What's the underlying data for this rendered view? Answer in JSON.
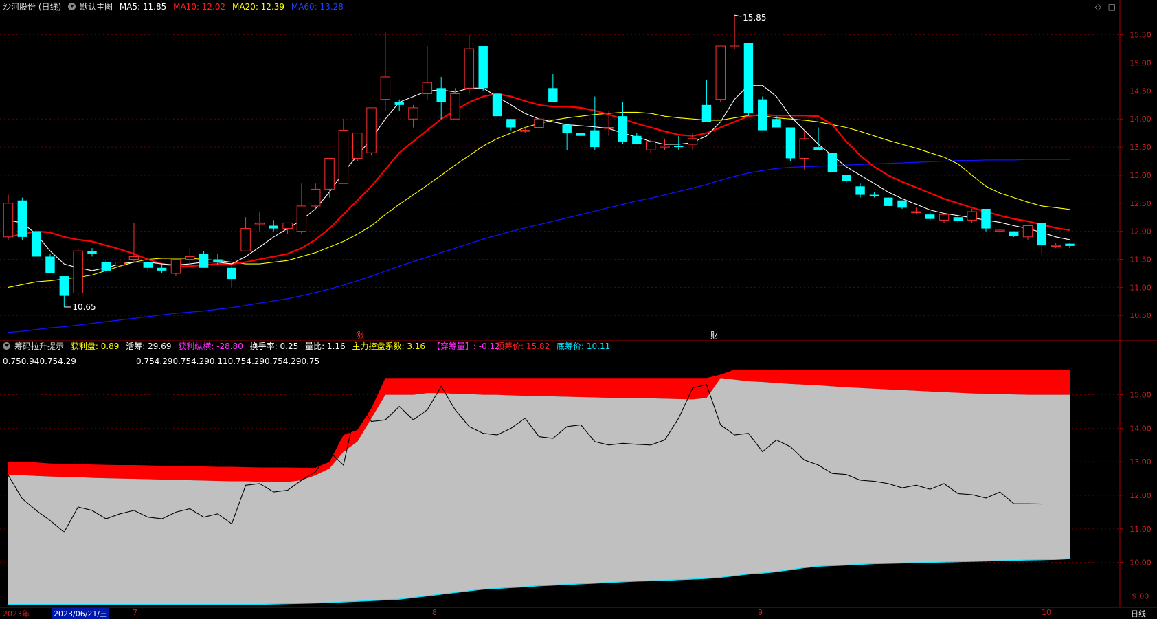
{
  "main_header": {
    "stock": "沙河股份 (日线)",
    "template": "默认主图",
    "ma5": "MA5: 11.85",
    "ma10": "MA10: 12.02",
    "ma20": "MA20: 12.39",
    "ma60": "MA60: 13.28"
  },
  "sub_header": {
    "name": "筹码拉升提示",
    "profit": "获利盘: 0.89",
    "active": "活筹: 29.69",
    "profit_vert": "获利纵横: -28.80",
    "turnover": "换手率: 0.25",
    "volume_ratio": "量比: 1.16",
    "control": "主力控盘系数: 3.16",
    "penetrate": "【穿筹量】: -0.12",
    "top_price": "顶筹价: 15.82",
    "bottom_price": "底筹价: 10.11"
  },
  "sub_values": {
    "left": "0.750.940.754.29",
    "mid": "0.754.290.754.290.110.754.290.754.290.75"
  },
  "annotations": {
    "high": "15.85",
    "low": "10.65",
    "marker_zhang": "涨",
    "marker_cai": "财"
  },
  "bottom_bar": {
    "year": "2023年",
    "date": "2023/06/21/三",
    "m7": "7",
    "m8": "8",
    "m9": "9",
    "m10": "10",
    "period": "日线"
  },
  "colors": {
    "up": "#ff3030",
    "down": "#00ffff",
    "ma5": "#ffffff",
    "ma10": "#ff0000",
    "ma20": "#ffff00",
    "ma60": "#1010ff",
    "axis": "#c00000"
  },
  "chart_data": [
    {
      "type": "candlestick",
      "title": "沙河股份 (日线)",
      "y_ticks": [
        15.5,
        15.0,
        14.5,
        14.0,
        13.5,
        13.0,
        12.5,
        12.0,
        11.5,
        11.0,
        10.5
      ],
      "ylim": [
        10.05,
        15.9
      ],
      "x_labels": [
        "7",
        "8",
        "9",
        "10"
      ],
      "candles": [
        {
          "o": 11.9,
          "h": 12.65,
          "l": 11.85,
          "c": 12.5
        },
        {
          "o": 12.55,
          "h": 12.6,
          "l": 11.85,
          "c": 11.9
        },
        {
          "o": 12.0,
          "h": 12.0,
          "l": 11.55,
          "c": 11.55
        },
        {
          "o": 11.55,
          "h": 11.6,
          "l": 11.25,
          "c": 11.25
        },
        {
          "o": 11.2,
          "h": 11.2,
          "l": 10.65,
          "c": 10.85
        },
        {
          "o": 10.9,
          "h": 11.7,
          "l": 10.85,
          "c": 11.65
        },
        {
          "o": 11.65,
          "h": 11.7,
          "l": 11.55,
          "c": 11.6
        },
        {
          "o": 11.45,
          "h": 11.5,
          "l": 11.25,
          "c": 11.3
        },
        {
          "o": 11.4,
          "h": 11.5,
          "l": 11.35,
          "c": 11.45
        },
        {
          "o": 11.5,
          "h": 12.15,
          "l": 11.45,
          "c": 11.55
        },
        {
          "o": 11.45,
          "h": 11.45,
          "l": 11.3,
          "c": 11.35
        },
        {
          "o": 11.35,
          "h": 11.4,
          "l": 11.25,
          "c": 11.3
        },
        {
          "o": 11.25,
          "h": 11.5,
          "l": 11.2,
          "c": 11.5
        },
        {
          "o": 11.5,
          "h": 11.7,
          "l": 11.4,
          "c": 11.55
        },
        {
          "o": 11.6,
          "h": 11.65,
          "l": 11.35,
          "c": 11.35
        },
        {
          "o": 11.5,
          "h": 11.6,
          "l": 11.4,
          "c": 11.45
        },
        {
          "o": 11.35,
          "h": 11.4,
          "l": 11.0,
          "c": 11.15
        },
        {
          "o": 11.65,
          "h": 12.25,
          "l": 11.65,
          "c": 12.05
        },
        {
          "o": 12.15,
          "h": 12.35,
          "l": 12.0,
          "c": 12.15
        },
        {
          "o": 12.1,
          "h": 12.2,
          "l": 12.0,
          "c": 12.05
        },
        {
          "o": 12.05,
          "h": 12.15,
          "l": 11.95,
          "c": 12.15
        },
        {
          "o": 12.0,
          "h": 12.85,
          "l": 11.95,
          "c": 12.45
        },
        {
          "o": 12.45,
          "h": 12.85,
          "l": 12.4,
          "c": 12.75
        },
        {
          "o": 12.75,
          "h": 13.1,
          "l": 12.6,
          "c": 13.3
        },
        {
          "o": 12.85,
          "h": 14.0,
          "l": 12.85,
          "c": 13.8
        },
        {
          "o": 13.3,
          "h": 13.75,
          "l": 13.25,
          "c": 13.75
        },
        {
          "o": 13.4,
          "h": 14.2,
          "l": 13.35,
          "c": 14.2
        },
        {
          "o": 14.35,
          "h": 15.55,
          "l": 14.15,
          "c": 14.75
        },
        {
          "o": 14.3,
          "h": 14.35,
          "l": 14.15,
          "c": 14.25
        },
        {
          "o": 14.0,
          "h": 14.25,
          "l": 13.85,
          "c": 14.2
        },
        {
          "o": 14.45,
          "h": 15.3,
          "l": 14.35,
          "c": 14.65
        },
        {
          "o": 14.55,
          "h": 14.75,
          "l": 14.0,
          "c": 14.3
        },
        {
          "o": 14.0,
          "h": 14.55,
          "l": 14.0,
          "c": 14.45
        },
        {
          "o": 14.55,
          "h": 15.5,
          "l": 14.45,
          "c": 15.25
        },
        {
          "o": 15.3,
          "h": 15.3,
          "l": 14.5,
          "c": 14.55
        },
        {
          "o": 14.45,
          "h": 14.5,
          "l": 14.0,
          "c": 14.05
        },
        {
          "o": 14.0,
          "h": 14.0,
          "l": 13.8,
          "c": 13.85
        },
        {
          "o": 13.8,
          "h": 13.85,
          "l": 13.75,
          "c": 13.8
        },
        {
          "o": 13.85,
          "h": 14.1,
          "l": 13.8,
          "c": 14.0
        },
        {
          "o": 14.55,
          "h": 14.8,
          "l": 14.3,
          "c": 14.3
        },
        {
          "o": 13.9,
          "h": 13.9,
          "l": 13.45,
          "c": 13.75
        },
        {
          "o": 13.75,
          "h": 13.8,
          "l": 13.55,
          "c": 13.7
        },
        {
          "o": 13.8,
          "h": 14.4,
          "l": 13.45,
          "c": 13.5
        },
        {
          "o": 13.85,
          "h": 14.15,
          "l": 13.7,
          "c": 13.85
        },
        {
          "o": 14.05,
          "h": 14.3,
          "l": 13.55,
          "c": 13.6
        },
        {
          "o": 13.7,
          "h": 13.75,
          "l": 13.55,
          "c": 13.55
        },
        {
          "o": 13.45,
          "h": 13.65,
          "l": 13.4,
          "c": 13.6
        },
        {
          "o": 13.5,
          "h": 13.65,
          "l": 13.45,
          "c": 13.52
        },
        {
          "o": 13.52,
          "h": 13.7,
          "l": 13.45,
          "c": 13.5
        },
        {
          "o": 13.55,
          "h": 13.75,
          "l": 13.45,
          "c": 13.65
        },
        {
          "o": 14.25,
          "h": 14.7,
          "l": 13.95,
          "c": 13.95
        },
        {
          "o": 14.35,
          "h": 15.3,
          "l": 14.3,
          "c": 15.3
        },
        {
          "o": 15.3,
          "h": 15.85,
          "l": 15.25,
          "c": 15.3
        },
        {
          "o": 15.35,
          "h": 15.35,
          "l": 14.05,
          "c": 14.1
        },
        {
          "o": 14.35,
          "h": 14.4,
          "l": 13.8,
          "c": 13.8
        },
        {
          "o": 14.0,
          "h": 14.05,
          "l": 13.85,
          "c": 13.85
        },
        {
          "o": 13.85,
          "h": 13.85,
          "l": 13.25,
          "c": 13.3
        },
        {
          "o": 13.3,
          "h": 13.8,
          "l": 13.1,
          "c": 13.65
        },
        {
          "o": 13.5,
          "h": 13.85,
          "l": 13.45,
          "c": 13.45
        },
        {
          "o": 13.4,
          "h": 13.4,
          "l": 13.05,
          "c": 13.05
        },
        {
          "o": 13.0,
          "h": 13.0,
          "l": 12.85,
          "c": 12.9
        },
        {
          "o": 12.8,
          "h": 12.85,
          "l": 12.6,
          "c": 12.65
        },
        {
          "o": 12.65,
          "h": 12.7,
          "l": 12.6,
          "c": 12.62
        },
        {
          "o": 12.6,
          "h": 12.6,
          "l": 12.45,
          "c": 12.45
        },
        {
          "o": 12.55,
          "h": 12.55,
          "l": 12.4,
          "c": 12.42
        },
        {
          "o": 12.35,
          "h": 12.42,
          "l": 12.3,
          "c": 12.35
        },
        {
          "o": 12.3,
          "h": 12.35,
          "l": 12.2,
          "c": 12.22
        },
        {
          "o": 12.2,
          "h": 12.3,
          "l": 12.15,
          "c": 12.3
        },
        {
          "o": 12.25,
          "h": 12.3,
          "l": 12.15,
          "c": 12.18
        },
        {
          "o": 12.2,
          "h": 12.4,
          "l": 12.15,
          "c": 12.35
        },
        {
          "o": 12.4,
          "h": 12.4,
          "l": 12.0,
          "c": 12.05
        },
        {
          "o": 12.0,
          "h": 12.05,
          "l": 11.95,
          "c": 12.02
        },
        {
          "o": 12.0,
          "h": 12.0,
          "l": 11.9,
          "c": 11.92
        },
        {
          "o": 11.9,
          "h": 12.1,
          "l": 11.85,
          "c": 12.1
        },
        {
          "o": 12.15,
          "h": 12.15,
          "l": 11.6,
          "c": 11.75
        },
        {
          "o": 11.75,
          "h": 11.8,
          "l": 11.7,
          "c": 11.75
        },
        {
          "o": 11.78,
          "h": 11.8,
          "l": 11.7,
          "c": 11.74
        }
      ],
      "ma5": [
        12.2,
        12.15,
        11.95,
        11.65,
        11.42,
        11.35,
        11.3,
        11.35,
        11.42,
        11.45,
        11.45,
        11.42,
        11.4,
        11.42,
        11.45,
        11.45,
        11.42,
        11.55,
        11.72,
        11.9,
        12.05,
        12.2,
        12.4,
        12.7,
        13.05,
        13.35,
        13.65,
        14.0,
        14.3,
        14.4,
        14.5,
        14.52,
        14.48,
        14.55,
        14.55,
        14.4,
        14.25,
        14.1,
        14.0,
        13.95,
        13.9,
        13.88,
        13.86,
        13.83,
        13.75,
        13.68,
        13.6,
        13.55,
        13.55,
        13.58,
        13.7,
        13.95,
        14.35,
        14.6,
        14.6,
        14.4,
        14.05,
        13.8,
        13.55,
        13.35,
        13.15,
        13.0,
        12.85,
        12.7,
        12.58,
        12.48,
        12.38,
        12.32,
        12.28,
        12.24,
        12.2,
        12.16,
        12.1,
        12.05,
        11.98,
        11.9,
        11.85
      ],
      "ma10": [
        11.9,
        11.95,
        12.0,
        11.98,
        11.9,
        11.85,
        11.82,
        11.75,
        11.68,
        11.6,
        11.5,
        11.42,
        11.38,
        11.38,
        11.4,
        11.42,
        11.42,
        11.45,
        11.5,
        11.55,
        11.6,
        11.7,
        11.85,
        12.05,
        12.3,
        12.55,
        12.8,
        13.1,
        13.4,
        13.6,
        13.8,
        14.0,
        14.15,
        14.3,
        14.4,
        14.45,
        14.4,
        14.32,
        14.25,
        14.22,
        14.22,
        14.2,
        14.15,
        14.08,
        14.0,
        13.92,
        13.85,
        13.78,
        13.72,
        13.7,
        13.75,
        13.85,
        13.95,
        14.05,
        14.08,
        14.06,
        14.06,
        14.06,
        14.05,
        13.9,
        13.6,
        13.35,
        13.15,
        13.0,
        12.88,
        12.78,
        12.68,
        12.58,
        12.5,
        12.42,
        12.35,
        12.28,
        12.22,
        12.18,
        12.12,
        12.06,
        12.02
      ],
      "ma20": [
        11.0,
        11.05,
        11.1,
        11.12,
        11.15,
        11.18,
        11.22,
        11.3,
        11.38,
        11.45,
        11.5,
        11.52,
        11.52,
        11.52,
        11.5,
        11.48,
        11.45,
        11.42,
        11.42,
        11.45,
        11.48,
        11.55,
        11.62,
        11.72,
        11.82,
        11.95,
        12.1,
        12.3,
        12.48,
        12.65,
        12.82,
        13.0,
        13.18,
        13.35,
        13.52,
        13.65,
        13.75,
        13.85,
        13.92,
        13.98,
        14.02,
        14.05,
        14.08,
        14.1,
        14.12,
        14.12,
        14.1,
        14.05,
        14.02,
        14.0,
        13.98,
        13.98,
        14.02,
        14.06,
        14.06,
        14.02,
        14.0,
        13.98,
        13.95,
        13.9,
        13.85,
        13.78,
        13.7,
        13.62,
        13.55,
        13.48,
        13.4,
        13.32,
        13.2,
        13.0,
        12.8,
        12.68,
        12.6,
        12.52,
        12.45,
        12.42,
        12.39
      ],
      "ma60": [
        10.2,
        10.22,
        10.25,
        10.28,
        10.3,
        10.33,
        10.36,
        10.39,
        10.42,
        10.45,
        10.48,
        10.51,
        10.54,
        10.56,
        10.58,
        10.61,
        10.64,
        10.68,
        10.72,
        10.76,
        10.8,
        10.85,
        10.91,
        10.97,
        11.04,
        11.12,
        11.2,
        11.29,
        11.38,
        11.46,
        11.54,
        11.62,
        11.7,
        11.78,
        11.86,
        11.93,
        12.0,
        12.06,
        12.12,
        12.18,
        12.24,
        12.3,
        12.36,
        12.42,
        12.48,
        12.54,
        12.59,
        12.65,
        12.71,
        12.77,
        12.83,
        12.91,
        12.98,
        13.04,
        13.08,
        13.12,
        13.14,
        13.15,
        13.16,
        13.17,
        13.18,
        13.19,
        13.2,
        13.21,
        13.22,
        13.23,
        13.24,
        13.25,
        13.26,
        13.26,
        13.27,
        13.27,
        13.27,
        13.28,
        13.28,
        13.28,
        13.28
      ]
    },
    {
      "type": "area",
      "title": "筹码拉升提示",
      "y_ticks": [
        15.0,
        14.0,
        13.0,
        12.0,
        11.0,
        10.0,
        9.0
      ],
      "ylim": [
        8.7,
        16.2
      ],
      "top_band": [
        13.0,
        13.0,
        12.98,
        12.95,
        12.94,
        12.93,
        12.92,
        12.91,
        12.9,
        12.9,
        12.89,
        12.88,
        12.87,
        12.87,
        12.86,
        12.85,
        12.85,
        12.84,
        12.83,
        12.83,
        12.83,
        12.82,
        12.82,
        13.0,
        13.8,
        13.95,
        14.6,
        15.5,
        15.5,
        15.5,
        15.5,
        15.5,
        15.5,
        15.5,
        15.5,
        15.5,
        15.5,
        15.5,
        15.5,
        15.5,
        15.5,
        15.5,
        15.5,
        15.5,
        15.5,
        15.5,
        15.5,
        15.5,
        15.5,
        15.5,
        15.5,
        15.6,
        15.75,
        15.75,
        15.75,
        15.75,
        15.75,
        15.75,
        15.75,
        15.75,
        15.75,
        15.75,
        15.75,
        15.75,
        15.75,
        15.75,
        15.75,
        15.75,
        15.75,
        15.75,
        15.75,
        15.75,
        15.75,
        15.75,
        15.75,
        15.75,
        15.75
      ],
      "upper": [
        12.6,
        12.6,
        12.58,
        12.56,
        12.55,
        12.54,
        12.52,
        12.51,
        12.5,
        12.49,
        12.48,
        12.47,
        12.46,
        12.45,
        12.44,
        12.43,
        12.42,
        12.42,
        12.41,
        12.4,
        12.4,
        12.45,
        12.6,
        12.8,
        13.3,
        13.6,
        14.3,
        15.0,
        15.0,
        15.0,
        15.05,
        15.05,
        15.03,
        15.02,
        15.0,
        15.0,
        14.98,
        14.97,
        14.96,
        14.95,
        14.94,
        14.93,
        14.92,
        14.91,
        14.9,
        14.9,
        14.89,
        14.88,
        14.87,
        14.86,
        14.9,
        15.5,
        15.45,
        15.4,
        15.38,
        15.35,
        15.32,
        15.3,
        15.28,
        15.25,
        15.22,
        15.2,
        15.18,
        15.16,
        15.14,
        15.12,
        15.1,
        15.08,
        15.06,
        15.04,
        15.03,
        15.02,
        15.01,
        15.0,
        15.0,
        15.0,
        15.0
      ],
      "lower": [
        8.75,
        8.75,
        8.75,
        8.75,
        8.75,
        8.75,
        8.75,
        8.75,
        8.75,
        8.75,
        8.75,
        8.75,
        8.75,
        8.75,
        8.75,
        8.75,
        8.75,
        8.75,
        8.75,
        8.76,
        8.77,
        8.78,
        8.79,
        8.8,
        8.82,
        8.84,
        8.86,
        8.88,
        8.9,
        8.95,
        9.0,
        9.05,
        9.1,
        9.15,
        9.2,
        9.22,
        9.25,
        9.27,
        9.3,
        9.32,
        9.34,
        9.36,
        9.38,
        9.4,
        9.42,
        9.44,
        9.45,
        9.46,
        9.48,
        9.5,
        9.52,
        9.55,
        9.6,
        9.65,
        9.68,
        9.72,
        9.78,
        9.84,
        9.88,
        9.9,
        9.92,
        9.94,
        9.96,
        9.97,
        9.98,
        9.99,
        10.0,
        10.01,
        10.02,
        10.03,
        10.04,
        10.05,
        10.06,
        10.07,
        10.08,
        10.09,
        10.11
      ],
      "line": [
        12.6,
        11.9,
        11.55,
        11.25,
        10.9,
        11.65,
        11.55,
        11.3,
        11.45,
        11.55,
        11.35,
        11.3,
        11.5,
        11.6,
        11.35,
        11.45,
        11.15,
        12.3,
        12.35,
        12.1,
        12.15,
        12.45,
        12.7,
        13.3,
        12.9,
        14.8,
        14.2,
        14.25,
        14.65,
        14.25,
        14.55,
        15.25,
        14.55,
        14.05,
        13.85,
        13.8,
        14.0,
        14.3,
        13.75,
        13.7,
        14.05,
        14.1,
        13.6,
        13.5,
        13.55,
        13.52,
        13.5,
        13.65,
        14.3,
        15.2,
        15.3,
        14.1,
        13.8,
        13.85,
        13.3,
        13.65,
        13.45,
        13.05,
        12.9,
        12.65,
        12.62,
        12.45,
        12.42,
        12.35,
        12.22,
        12.3,
        12.18,
        12.35,
        12.05,
        12.02,
        11.92,
        12.1,
        11.75,
        11.75,
        11.74
      ]
    }
  ]
}
